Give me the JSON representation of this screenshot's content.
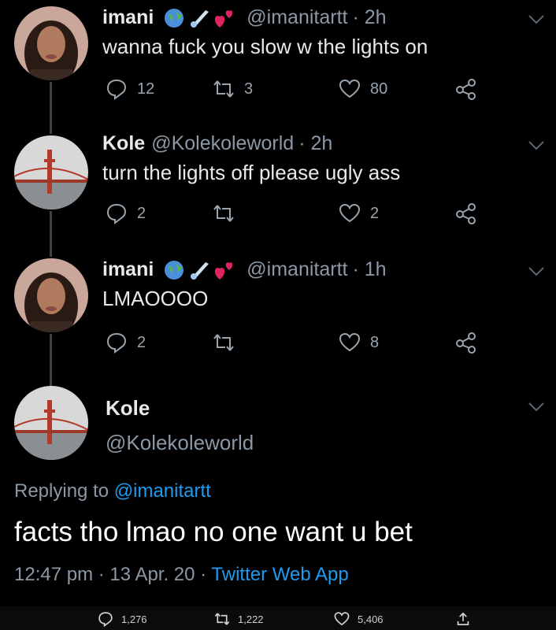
{
  "colors": {
    "background": "#000000",
    "text": "#e7e9ea",
    "muted": "#8b98a5",
    "link": "#1d9bf0",
    "heart": "#e0245e"
  },
  "tweets": [
    {
      "name": "imani",
      "emojis": [
        "globe-icon",
        "comet-icon",
        "hearts-icon"
      ],
      "handle": "@imanitartt",
      "time": "· 2h",
      "text": "wanna fuck you slow w the lights on",
      "replies": "12",
      "retweets": "3",
      "likes": "80"
    },
    {
      "name": "Kole",
      "handle": "@Kolekoleworld",
      "time": "· 2h",
      "text": "turn the lights off please ugly ass",
      "replies": "2",
      "retweets": "",
      "likes": "2"
    },
    {
      "name": "imani",
      "emojis": [
        "globe-icon",
        "comet-icon",
        "hearts-icon"
      ],
      "handle": "@imanitartt",
      "time": "· 1h",
      "text": "LMAOOOO",
      "replies": "2",
      "retweets": "",
      "likes": "8"
    }
  ],
  "main_tweet": {
    "name": "Kole",
    "handle": "@Kolekoleworld",
    "replying_prefix": "Replying to ",
    "replying_handle": "@imanitartt",
    "text": "facts tho lmao no one want u bet",
    "time": "12:47 pm",
    "date": "· 13 Apr. 20 ·",
    "source": "Twitter Web App"
  },
  "bottom_bar": {
    "replies": "1,276",
    "retweets": "1,222",
    "likes": "5,406"
  }
}
